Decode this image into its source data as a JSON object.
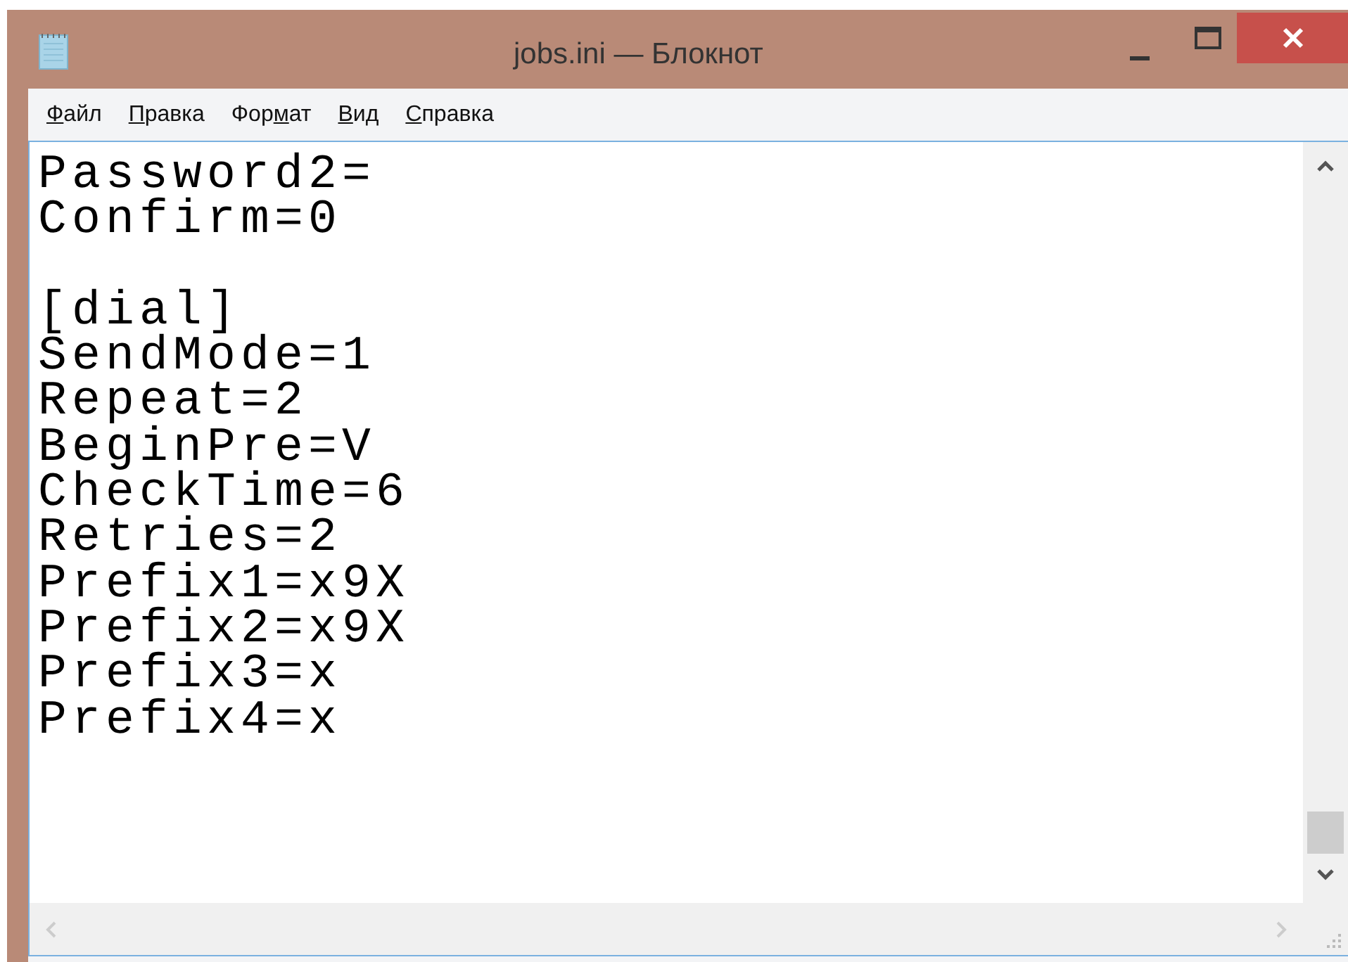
{
  "window": {
    "title": "jobs.ini — Блокнот"
  },
  "menu": [
    {
      "key": "Ф",
      "after": "айл"
    },
    {
      "key": "П",
      "after": "равка"
    },
    {
      "before": "Фор",
      "key": "м",
      "after": "ат"
    },
    {
      "key": "В",
      "after": "ид"
    },
    {
      "key": "С",
      "after": "правка"
    }
  ],
  "editor": {
    "blocks": [
      [
        "Password2=",
        "Confirm=0"
      ],
      [
        "[dial]",
        "SendMode=1",
        "Repeat=2",
        "BeginPre=V",
        "CheckTime=6",
        "Retries=2",
        "Prefix1=x9X",
        "Prefix2=x9X",
        "Prefix3=x",
        "Prefix4=x"
      ]
    ]
  }
}
